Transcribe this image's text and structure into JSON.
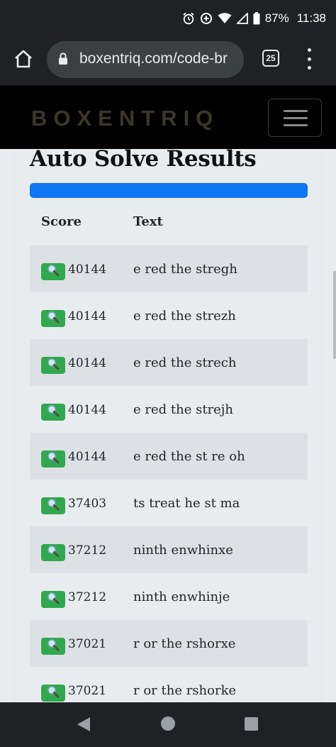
{
  "status_bar": {
    "battery": "87%",
    "time": "11:38"
  },
  "browser": {
    "url": "boxentriq.com/code-br",
    "tab_count": "25"
  },
  "site": {
    "logo": "BOXENTRIQ"
  },
  "page": {
    "title": "Auto Solve Results",
    "progress_percent": 100
  },
  "table": {
    "headers": {
      "score": "Score",
      "text": "Text"
    },
    "rows": [
      {
        "score": "40144",
        "text": "e red the stregh"
      },
      {
        "score": "40144",
        "text": "e red the strezh"
      },
      {
        "score": "40144",
        "text": "e red the strech"
      },
      {
        "score": "40144",
        "text": "e red the strejh"
      },
      {
        "score": "40144",
        "text": "e red the st re oh"
      },
      {
        "score": "37403",
        "text": "ts treat he st ma"
      },
      {
        "score": "37212",
        "text": "ninth enwhinxe"
      },
      {
        "score": "37212",
        "text": "ninth enwhinje"
      },
      {
        "score": "37021",
        "text": "r or the rshorxe"
      },
      {
        "score": "37021",
        "text": "r or the rshorke"
      }
    ]
  },
  "colors": {
    "progress": "#0d76f2",
    "zoom_button": "#2fa84f",
    "stripe": "#dde1e5"
  }
}
